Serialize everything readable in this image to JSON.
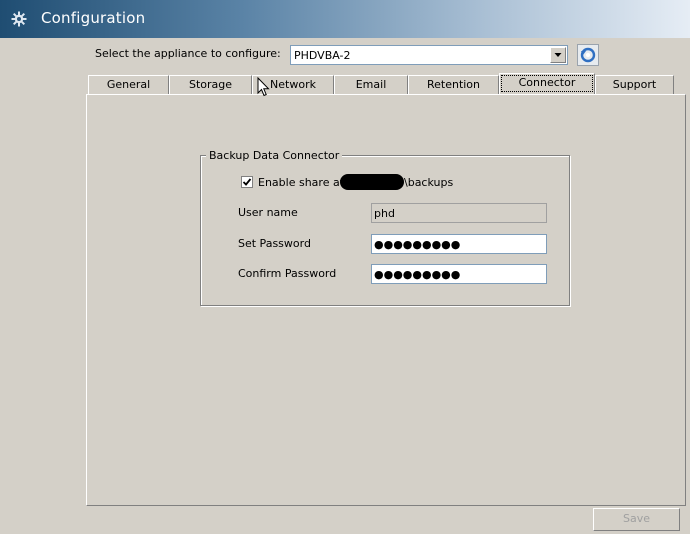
{
  "window": {
    "title": "Configuration",
    "icon": "gear-icon"
  },
  "appliance": {
    "label": "Select the appliance to configure:",
    "selected": "PHDVBA-2",
    "refresh_icon": "refresh-icon"
  },
  "tabs": [
    {
      "label": "General"
    },
    {
      "label": "Storage"
    },
    {
      "label": "Network"
    },
    {
      "label": "Email"
    },
    {
      "label": "Retention"
    },
    {
      "label": "Connector",
      "active": true
    },
    {
      "label": "Support"
    }
  ],
  "connector": {
    "group_title": "Backup Data Connector",
    "enable_share": {
      "checked": true,
      "label_prefix": "Enable share at \\\\",
      "label_suffix": "\\backups"
    },
    "username": {
      "label": "User name",
      "value": "phd"
    },
    "set_password": {
      "label": "Set Password",
      "value": "●●●●●●●●●"
    },
    "confirm_password": {
      "label": "Confirm Password",
      "value": "●●●●●●●●●"
    }
  },
  "footer": {
    "save_label": "Save"
  },
  "colors": {
    "background": "#d4d0c8",
    "title_dark": "#1f4d72",
    "field_border": "#7f9db9"
  }
}
